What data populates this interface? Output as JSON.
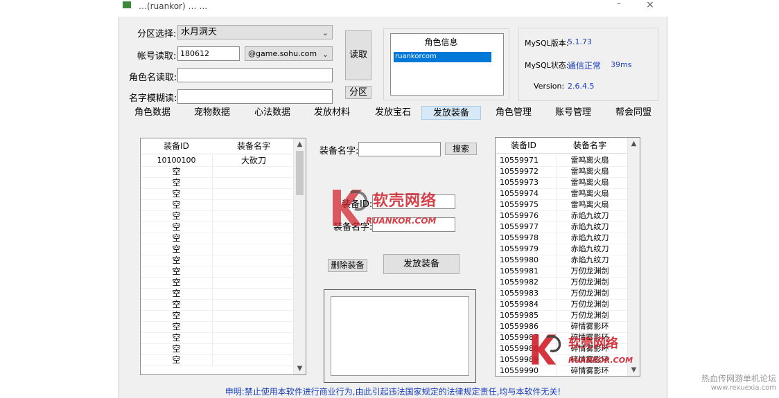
{
  "window": {
    "title": "…(ruankor) …  …"
  },
  "form": {
    "zone_label": "分区选择:",
    "zone_value": "水月洞天",
    "account_label": "帐号读取:",
    "account_value": "180612",
    "domain_value": "@game.sohu.com",
    "rolename_label": "角色名读取:",
    "rolename_value": "",
    "fuzzy_label": "名字模糊读:",
    "fuzzy_value": "",
    "read_button": "读取",
    "zone_button": "分区"
  },
  "role_info": {
    "header": "角色信息",
    "items": [
      "ruankorcom"
    ]
  },
  "mysql": {
    "version_label": "MySQL版本:",
    "version_value": "5.1.73",
    "status_label": "MySQL状态:",
    "status_value": "通信正常",
    "latency": "39ms",
    "app_version_label": "Version:",
    "app_version_value": "2.6.4.5"
  },
  "tabs": [
    {
      "label": "角色数据",
      "active": false
    },
    {
      "label": "宠物数据",
      "active": false
    },
    {
      "label": "心法数据",
      "active": false
    },
    {
      "label": "发放材料",
      "active": false
    },
    {
      "label": "发放宝石",
      "active": false
    },
    {
      "label": "发放装备",
      "active": true
    },
    {
      "label": "角色管理",
      "active": false
    },
    {
      "label": "账号管理",
      "active": false
    },
    {
      "label": "帮会同盟",
      "active": false
    }
  ],
  "left_list": {
    "columns": [
      "装备ID",
      "装备名字"
    ],
    "rows": [
      [
        "10100100",
        "大砍刀"
      ],
      [
        "空",
        ""
      ],
      [
        "空",
        ""
      ],
      [
        "空",
        ""
      ],
      [
        "空",
        ""
      ],
      [
        "空",
        ""
      ],
      [
        "空",
        ""
      ],
      [
        "空",
        ""
      ],
      [
        "空",
        ""
      ],
      [
        "空",
        ""
      ],
      [
        "空",
        ""
      ],
      [
        "空",
        ""
      ],
      [
        "空",
        ""
      ],
      [
        "空",
        ""
      ],
      [
        "空",
        ""
      ],
      [
        "空",
        ""
      ],
      [
        "空",
        ""
      ],
      [
        "空",
        ""
      ],
      [
        "空",
        ""
      ]
    ]
  },
  "center": {
    "search_label": "装备名字:",
    "search_value": "",
    "search_button": "搜索",
    "equip_id_label": "装备ID:",
    "equip_id_value": "",
    "equip_name_label": "装备名字:",
    "equip_name_value": "",
    "delete_button": "删除装备",
    "issue_button": "发放装备",
    "log_text": ""
  },
  "right_list": {
    "columns": [
      "装备ID",
      "装备名字"
    ],
    "rows": [
      [
        "10559971",
        "雷鸣离火扇"
      ],
      [
        "10559972",
        "雷鸣离火扇"
      ],
      [
        "10559973",
        "雷鸣离火扇"
      ],
      [
        "10559974",
        "雷鸣离火扇"
      ],
      [
        "10559975",
        "雷鸣离火扇"
      ],
      [
        "10559976",
        "赤焰九纹刀"
      ],
      [
        "10559977",
        "赤焰九纹刀"
      ],
      [
        "10559978",
        "赤焰九纹刀"
      ],
      [
        "10559979",
        "赤焰九纹刀"
      ],
      [
        "10559980",
        "赤焰九纹刀"
      ],
      [
        "10559981",
        "万仞龙渊剑"
      ],
      [
        "10559982",
        "万仞龙渊剑"
      ],
      [
        "10559983",
        "万仞龙渊剑"
      ],
      [
        "10559984",
        "万仞龙渊剑"
      ],
      [
        "10559985",
        "万仞龙渊剑"
      ],
      [
        "10559986",
        "碎情雾影环"
      ],
      [
        "10559987",
        "碎情雾影环"
      ],
      [
        "10559988",
        "碎情雾影环"
      ],
      [
        "10559989",
        "碎情雾影环"
      ],
      [
        "10559990",
        "碎情雾影环"
      ]
    ]
  },
  "footer": {
    "disclaimer": "申明:禁止使用本软件进行商业行为,由此引起违法国家规定的法律规定责任,均与本软件无关!"
  },
  "watermarks": {
    "brand_cn": "软壳网络",
    "brand_en": "RUANKOR.COM",
    "site_cn": "热血传网游单机论坛",
    "site_url": "www.rexuexia.com"
  },
  "colors": {
    "accent_blue": "#1a3fb8",
    "watermark_red": "#d1202a",
    "selection_blue": "#0078d7",
    "active_tab": "#d7e8f7"
  }
}
